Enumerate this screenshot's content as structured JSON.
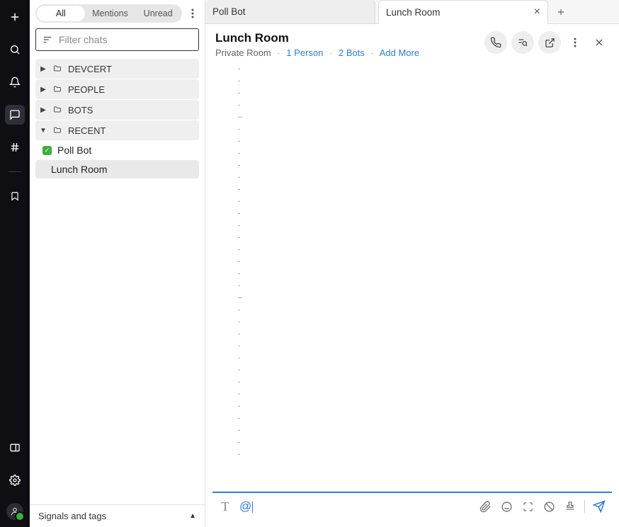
{
  "rail": {
    "icons": [
      "plus",
      "search",
      "bell",
      "chat",
      "hash",
      "bookmark",
      "panel",
      "gear",
      "avatar"
    ]
  },
  "sidebar": {
    "segments": {
      "all": "All",
      "mentions": "Mentions",
      "unread": "Unread"
    },
    "filter_placeholder": "Filter chats",
    "folders": [
      {
        "label": "DEVCERT",
        "expanded": false
      },
      {
        "label": "PEOPLE",
        "expanded": false
      },
      {
        "label": "BOTS",
        "expanded": false
      },
      {
        "label": "RECENT",
        "expanded": true
      }
    ],
    "recent_items": [
      {
        "label": "Poll Bot",
        "status": "online",
        "selected": false
      },
      {
        "label": "Lunch Room",
        "status": null,
        "selected": true
      }
    ],
    "footer_label": "Signals and tags"
  },
  "tabs": [
    {
      "label": "Poll Bot",
      "active": false,
      "closable": false
    },
    {
      "label": "Lunch Room",
      "active": true,
      "closable": true
    }
  ],
  "room": {
    "title": "Lunch Room",
    "type": "Private Room",
    "people": "1 Person",
    "bots": "2 Bots",
    "add_more": "Add More"
  },
  "messages_dot_rows": 33,
  "compose": {
    "at_symbol": "@"
  }
}
